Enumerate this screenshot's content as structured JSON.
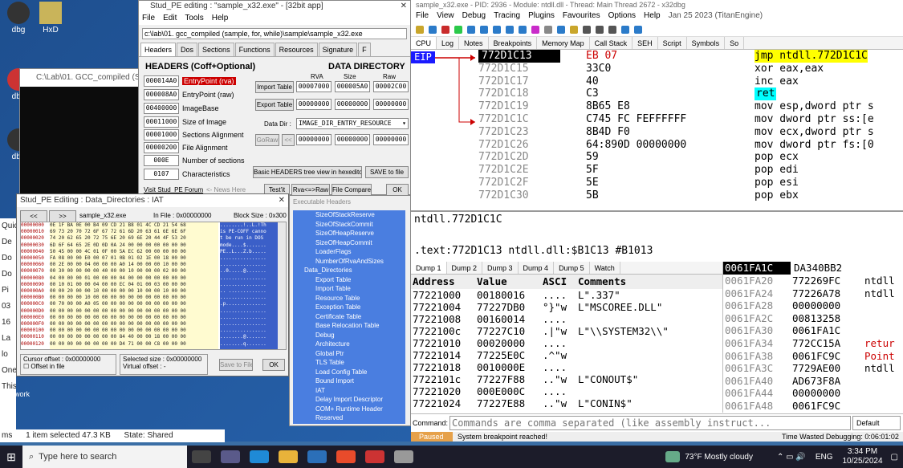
{
  "desktop": {
    "icons": [
      {
        "label": "dbg"
      },
      {
        "label": "HxD"
      },
      {
        "label": "dbg"
      },
      {
        "label": "dbg"
      }
    ],
    "explorer": {
      "sidebar_items": [
        "Quic",
        "De",
        "Do",
        "Do",
        "Pi",
        "03",
        "16",
        "La",
        "lo",
        "One",
        "This",
        "Network"
      ],
      "status_items": "1 item selected  47.3 KB",
      "state": "State: Shared",
      "ms_label": "ms"
    },
    "console_title": "C:\\Lab\\01. GCC_compiled (Samp"
  },
  "studpe": {
    "title": "Stud_PE editing : \"sample_x32.exe\" - [32bit app]",
    "menu": [
      "File",
      "Edit",
      "Tools",
      "Help"
    ],
    "path": "c:\\lab\\01. gcc_compiled (sample, for, while)\\sample\\sample_x32.exe",
    "tabs": [
      "Headers",
      "Dos",
      "Sections",
      "Functions",
      "Resources",
      "Signature",
      "F"
    ],
    "headers_title": "HEADERS (Coff+Optional)",
    "data_dir_title": "DATA DIRECTORY",
    "col_rva": "RVA",
    "col_size": "Size",
    "col_raw": "Raw",
    "fields": [
      {
        "value": "000014A0",
        "label": "EntryPoint (rva)"
      },
      {
        "value": "000008A0",
        "label": "EntryPoint (raw)"
      },
      {
        "value": "00400000",
        "label": "ImageBase"
      },
      {
        "value": "00011000",
        "label": "Size of Image"
      },
      {
        "value": "00001000",
        "label": "Sections Alignment"
      },
      {
        "value": "00000200",
        "label": "File Alignment"
      },
      {
        "value": "000E",
        "label": "Number of sections"
      },
      {
        "value": "0107",
        "label": "Characteristics"
      }
    ],
    "import_table": {
      "label": "Import Table",
      "rva": "00007000",
      "size": "000005A0",
      "raw": "00002C00"
    },
    "export_table": {
      "label": "Export Table",
      "rva": "00000000",
      "size": "00000000",
      "raw": "00000000"
    },
    "data_dir_label": "Data Dir :",
    "data_dir_select": "IMAGE_DIR_ENTRY_RESOURCE",
    "goraw": "GoRaw",
    "arrows": "<<",
    "dd_rva": "00000000",
    "dd_size": "00000000",
    "dd_raw": "00000000",
    "basic_btn": "Basic HEADERS tree view in hexeditor",
    "save_btn": "SAVE to file",
    "forum_link": "Visit Stud_PE Forum",
    "news": "<- News Here",
    "testit": "Test'it",
    "rva_raw": "Rva<=>Raw",
    "file_compare": "File Compare",
    "ok": "OK"
  },
  "ddwin": {
    "title": "Stud_PE Editing : Data_Directories : IAT",
    "nav_prev": "<<",
    "nav_next": ">>",
    "file": "sample_x32.exe",
    "in_file": "In File : 0x00000000",
    "block": "Block Size : 0x300",
    "hex_addrs": [
      "00000000",
      "00000010",
      "00000020",
      "00000030",
      "00000040",
      "00000050",
      "00000060",
      "00000070",
      "00000080",
      "00000090",
      "000000A0",
      "000000B0",
      "000000C0",
      "000000D0",
      "000000E0",
      "000000F0",
      "00000100",
      "00000110",
      "00000120"
    ],
    "hex_rows": [
      "0E 1F BA 0E 00 B4 09 CD 21 B8 01 4C CD 21 54 68",
      "69 73 20 70 72 6F 67 72 61 6D 20 63 61 6E 6E 6F",
      "74 20 62 65 20 72 75 6E 20 69 6E 20 44 4F 53 20",
      "6D 6F 64 65 2E 0D 0D 0A 24 00 00 00 00 00 00 00",
      "50 45 00 00 4C 01 0F 00 5A EC 62 00 00 00 00 00",
      "FA 08 00 00 E0 00 07 01 0B 01 02 1E 00 18 00 00",
      "00 2E 00 00 04 00 00 00 A0 14 00 00 00 10 00 00",
      "00 30 00 00 00 00 40 00 00 10 00 00 00 02 00 00",
      "04 00 00 00 01 00 00 00 04 00 00 00 00 00 00 00",
      "00 10 01 00 00 04 00 00 EC 04 01 00 03 00 00 00",
      "00 00 20 00 00 10 00 00 00 00 10 00 00 10 00 00",
      "00 00 00 00 10 00 00 00 00 00 00 00 00 00 00 00",
      "00 70 00 00 A0 05 00 00 00 00 00 00 00 00 00 00",
      "00 00 00 00 00 00 00 00 00 00 00 00 00 00 00 00",
      "00 00 00 00 00 00 00 00 00 00 00 00 00 00 00 00",
      "00 00 00 00 00 00 00 00 00 00 00 00 00 00 00 00",
      "00 00 00 00 00 00 00 00 00 00 00 00 00 00 00 00",
      "00 00 00 00 00 00 00 00 84 40 00 00 18 00 00 00",
      "00 00 00 00 00 00 00 00 D4 71 00 00 C8 00 00 00"
    ],
    "ascii_rows": [
      "........!..L.!Th",
      "is PE-COFF canno",
      "t be run in DOS ",
      "mode....$.......",
      "PE..L...Z.b.....",
      "................",
      "................",
      "..0.....@.......",
      "................",
      "................",
      ".. .............",
      "................",
      ".p..............",
      "................",
      "................",
      "................",
      "................",
      "........@.......",
      "........q......."
    ],
    "cursor_offset": "Cursor offset : 0x00000000",
    "offset_in_file": "Offset in file",
    "selected_size": "Selected size : 0x00000000",
    "virtual_offset": "Virtual offset :",
    "dash": "-",
    "save_to_file": "Save to File",
    "ok": "OK"
  },
  "tree": {
    "title": "Executable Headers",
    "items": [
      "SizeOfStackReserve",
      "SizeOfStackCommit",
      "SizeOfHeapReserve",
      "SizeOfHeapCommit",
      "LoaderFlags",
      "NumberOfRvaAndSizes",
      "Data_Directories",
      "Export Table",
      "Import Table",
      "Resource Table",
      "Exception Table",
      "Certificate Table",
      "Base Relocation Table",
      "Debug",
      "Architecture",
      "Global Ptr",
      "TLS Table",
      "Load Config Table",
      "Bound Import",
      "IAT",
      "Delay Import Descriptor",
      "COM+ Runtime Header",
      "Reserved"
    ]
  },
  "dbg": {
    "title": "sample_x32.exe - PID: 2936 - Module: ntdll.dll - Thread: Main Thread 2672 - x32dbg",
    "menu": [
      "File",
      "View",
      "Debug",
      "Tracing",
      "Plugins",
      "Favourites",
      "Options",
      "Help",
      "Jan 25 2023 (TitanEngine)"
    ],
    "tabs": [
      "CPU",
      "Log",
      "Notes",
      "Breakpoints",
      "Memory Map",
      "Call Stack",
      "SEH",
      "Script",
      "Symbols",
      "So"
    ],
    "eip": "EIP",
    "disasm": [
      {
        "addr": "772D1C13",
        "bytes": "EB 07",
        "instr": "jmp ntdll.772D1C1C"
      },
      {
        "addr": "772D1C15",
        "bytes": "33C0",
        "instr": "xor eax,eax"
      },
      {
        "addr": "772D1C17",
        "bytes": "40",
        "instr": "inc eax"
      },
      {
        "addr": "772D1C18",
        "bytes": "C3",
        "instr": "ret"
      },
      {
        "addr": "772D1C19",
        "bytes": "8B65 E8",
        "instr": "mov esp,dword ptr s"
      },
      {
        "addr": "772D1C1C",
        "bytes": "C745 FC FEFFFFFF",
        "instr": "mov dword ptr ss:[e"
      },
      {
        "addr": "772D1C23",
        "bytes": "8B4D F0",
        "instr": "mov ecx,dword ptr s"
      },
      {
        "addr": "772D1C26",
        "bytes": "64:890D 00000000",
        "instr": "mov dword ptr fs:[0"
      },
      {
        "addr": "772D1C2D",
        "bytes": "59",
        "instr": "pop ecx"
      },
      {
        "addr": "772D1C2E",
        "bytes": "5F",
        "instr": "pop edi"
      },
      {
        "addr": "772D1C2F",
        "bytes": "5E",
        "instr": "pop esi"
      },
      {
        "addr": "772D1C30",
        "bytes": "5B",
        "instr": "pop ebx"
      }
    ],
    "info1": "ntdll.772D1C1C",
    "info2": ".text:772D1C13 ntdll.dll:$B1C13 #B1013",
    "dump_tabs": [
      "Dump 1",
      "Dump 2",
      "Dump 3",
      "Dump 4",
      "Dump 5",
      "Watch"
    ],
    "dump_headers": [
      "Address",
      "Value",
      "ASCI",
      "Comments"
    ],
    "dump_rows": [
      {
        "addr": "77221000",
        "val": "00180016",
        "asc": "....",
        "cmt": "L\".337\""
      },
      {
        "addr": "77221004",
        "val": "77227DB0",
        "asc": "°}\"w",
        "cmt": "L\"MSCOREE.DLL\""
      },
      {
        "addr": "77221008",
        "val": "00160014",
        "asc": "....",
        "cmt": ""
      },
      {
        "addr": "7722100c",
        "val": "77227C10",
        "asc": ".|\"w",
        "cmt": "L\"\\\\SYSTEM32\\\\\""
      },
      {
        "addr": "77221010",
        "val": "00020000",
        "asc": "....",
        "cmt": ""
      },
      {
        "addr": "77221014",
        "val": "77225E0C",
        "asc": ".^\"w",
        "cmt": ""
      },
      {
        "addr": "77221018",
        "val": "0010000E",
        "asc": "....",
        "cmt": ""
      },
      {
        "addr": "7722101c",
        "val": "77227F88",
        "asc": "..\"w",
        "cmt": "L\"CONOUT$\""
      },
      {
        "addr": "77221020",
        "val": "000E000C",
        "asc": "....",
        "cmt": ""
      },
      {
        "addr": "77221024",
        "val": "77227E88",
        "asc": "..\"w",
        "cmt": "L\"CONIN$\""
      }
    ],
    "stack_top": {
      "addr": "0061FA1C",
      "val": "DA340BB2"
    },
    "stack_rows": [
      {
        "addr": "0061FA20",
        "val": "772269FC",
        "cmt": "ntdll"
      },
      {
        "addr": "0061FA24",
        "val": "77226A78",
        "cmt": "ntdll"
      },
      {
        "addr": "0061FA28",
        "val": "00000000",
        "cmt": ""
      },
      {
        "addr": "0061FA2C",
        "val": "00813258",
        "cmt": ""
      },
      {
        "addr": "0061FA30",
        "val": "0061FA1C",
        "cmt": ""
      },
      {
        "addr": "0061FA34",
        "val": "772CC15A",
        "cmt": "retur"
      },
      {
        "addr": "0061FA38",
        "val": "0061FC9C",
        "cmt": "Point"
      },
      {
        "addr": "0061FA3C",
        "val": "7729AE00",
        "cmt": "ntdll"
      },
      {
        "addr": "0061FA40",
        "val": "AD673F8A",
        "cmt": ""
      },
      {
        "addr": "0061FA44",
        "val": "00000000",
        "cmt": ""
      },
      {
        "addr": "0061FA48",
        "val": "0061FC9C",
        "cmt": ""
      }
    ],
    "cmd_label": "Command:",
    "cmd_placeholder": "Commands are comma separated (like assembly instruct...",
    "cmd_mode": "Default",
    "status_state": "Paused",
    "status_msg": "System breakpoint reached!",
    "time_wasted": "Time Wasted Debugging: 0:06:01:02"
  },
  "taskbar": {
    "search_placeholder": "Type here to search",
    "weather": "73°F  Mostly cloudy",
    "lang": "ENG",
    "time": "3:34 PM",
    "date": "10/25/2024"
  },
  "colors": {
    "eip_bg": "#1a1aff",
    "sel_bg": "#000000",
    "jmp_bg": "#ffff00",
    "ret_bg": "#00ffff",
    "tree_bg": "#4a7ee0",
    "ascii_bg": "#3b5fc8"
  }
}
